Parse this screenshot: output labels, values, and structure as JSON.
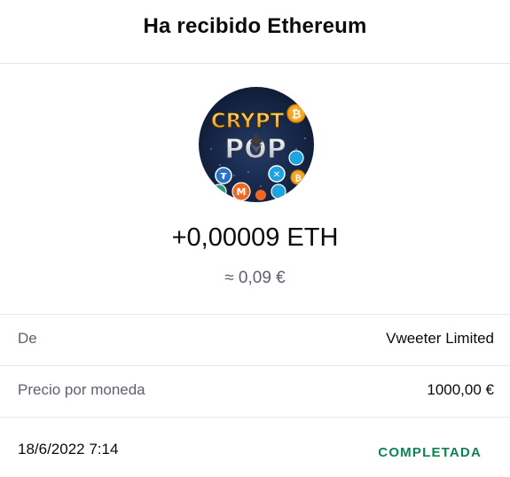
{
  "header": {
    "title": "Ha recibido Ethereum"
  },
  "asset": {
    "logo_text_top": "CRYPT",
    "logo_text_bottom": "POP",
    "icon": "crypto-pop-logo-icon"
  },
  "transaction": {
    "amount": "+0,00009 ETH",
    "fiat_value": "≈ 0,09 €",
    "from_label": "De",
    "from_value": "Vweeter Limited",
    "price_label": "Precio por moneda",
    "price_value": "1000,00 €",
    "date": "18/6/2022 7:14",
    "status": "COMPLETADA"
  },
  "colors": {
    "status_green": "#098551",
    "secondary_text": "#5b616e",
    "divider": "#e6e7ea"
  }
}
